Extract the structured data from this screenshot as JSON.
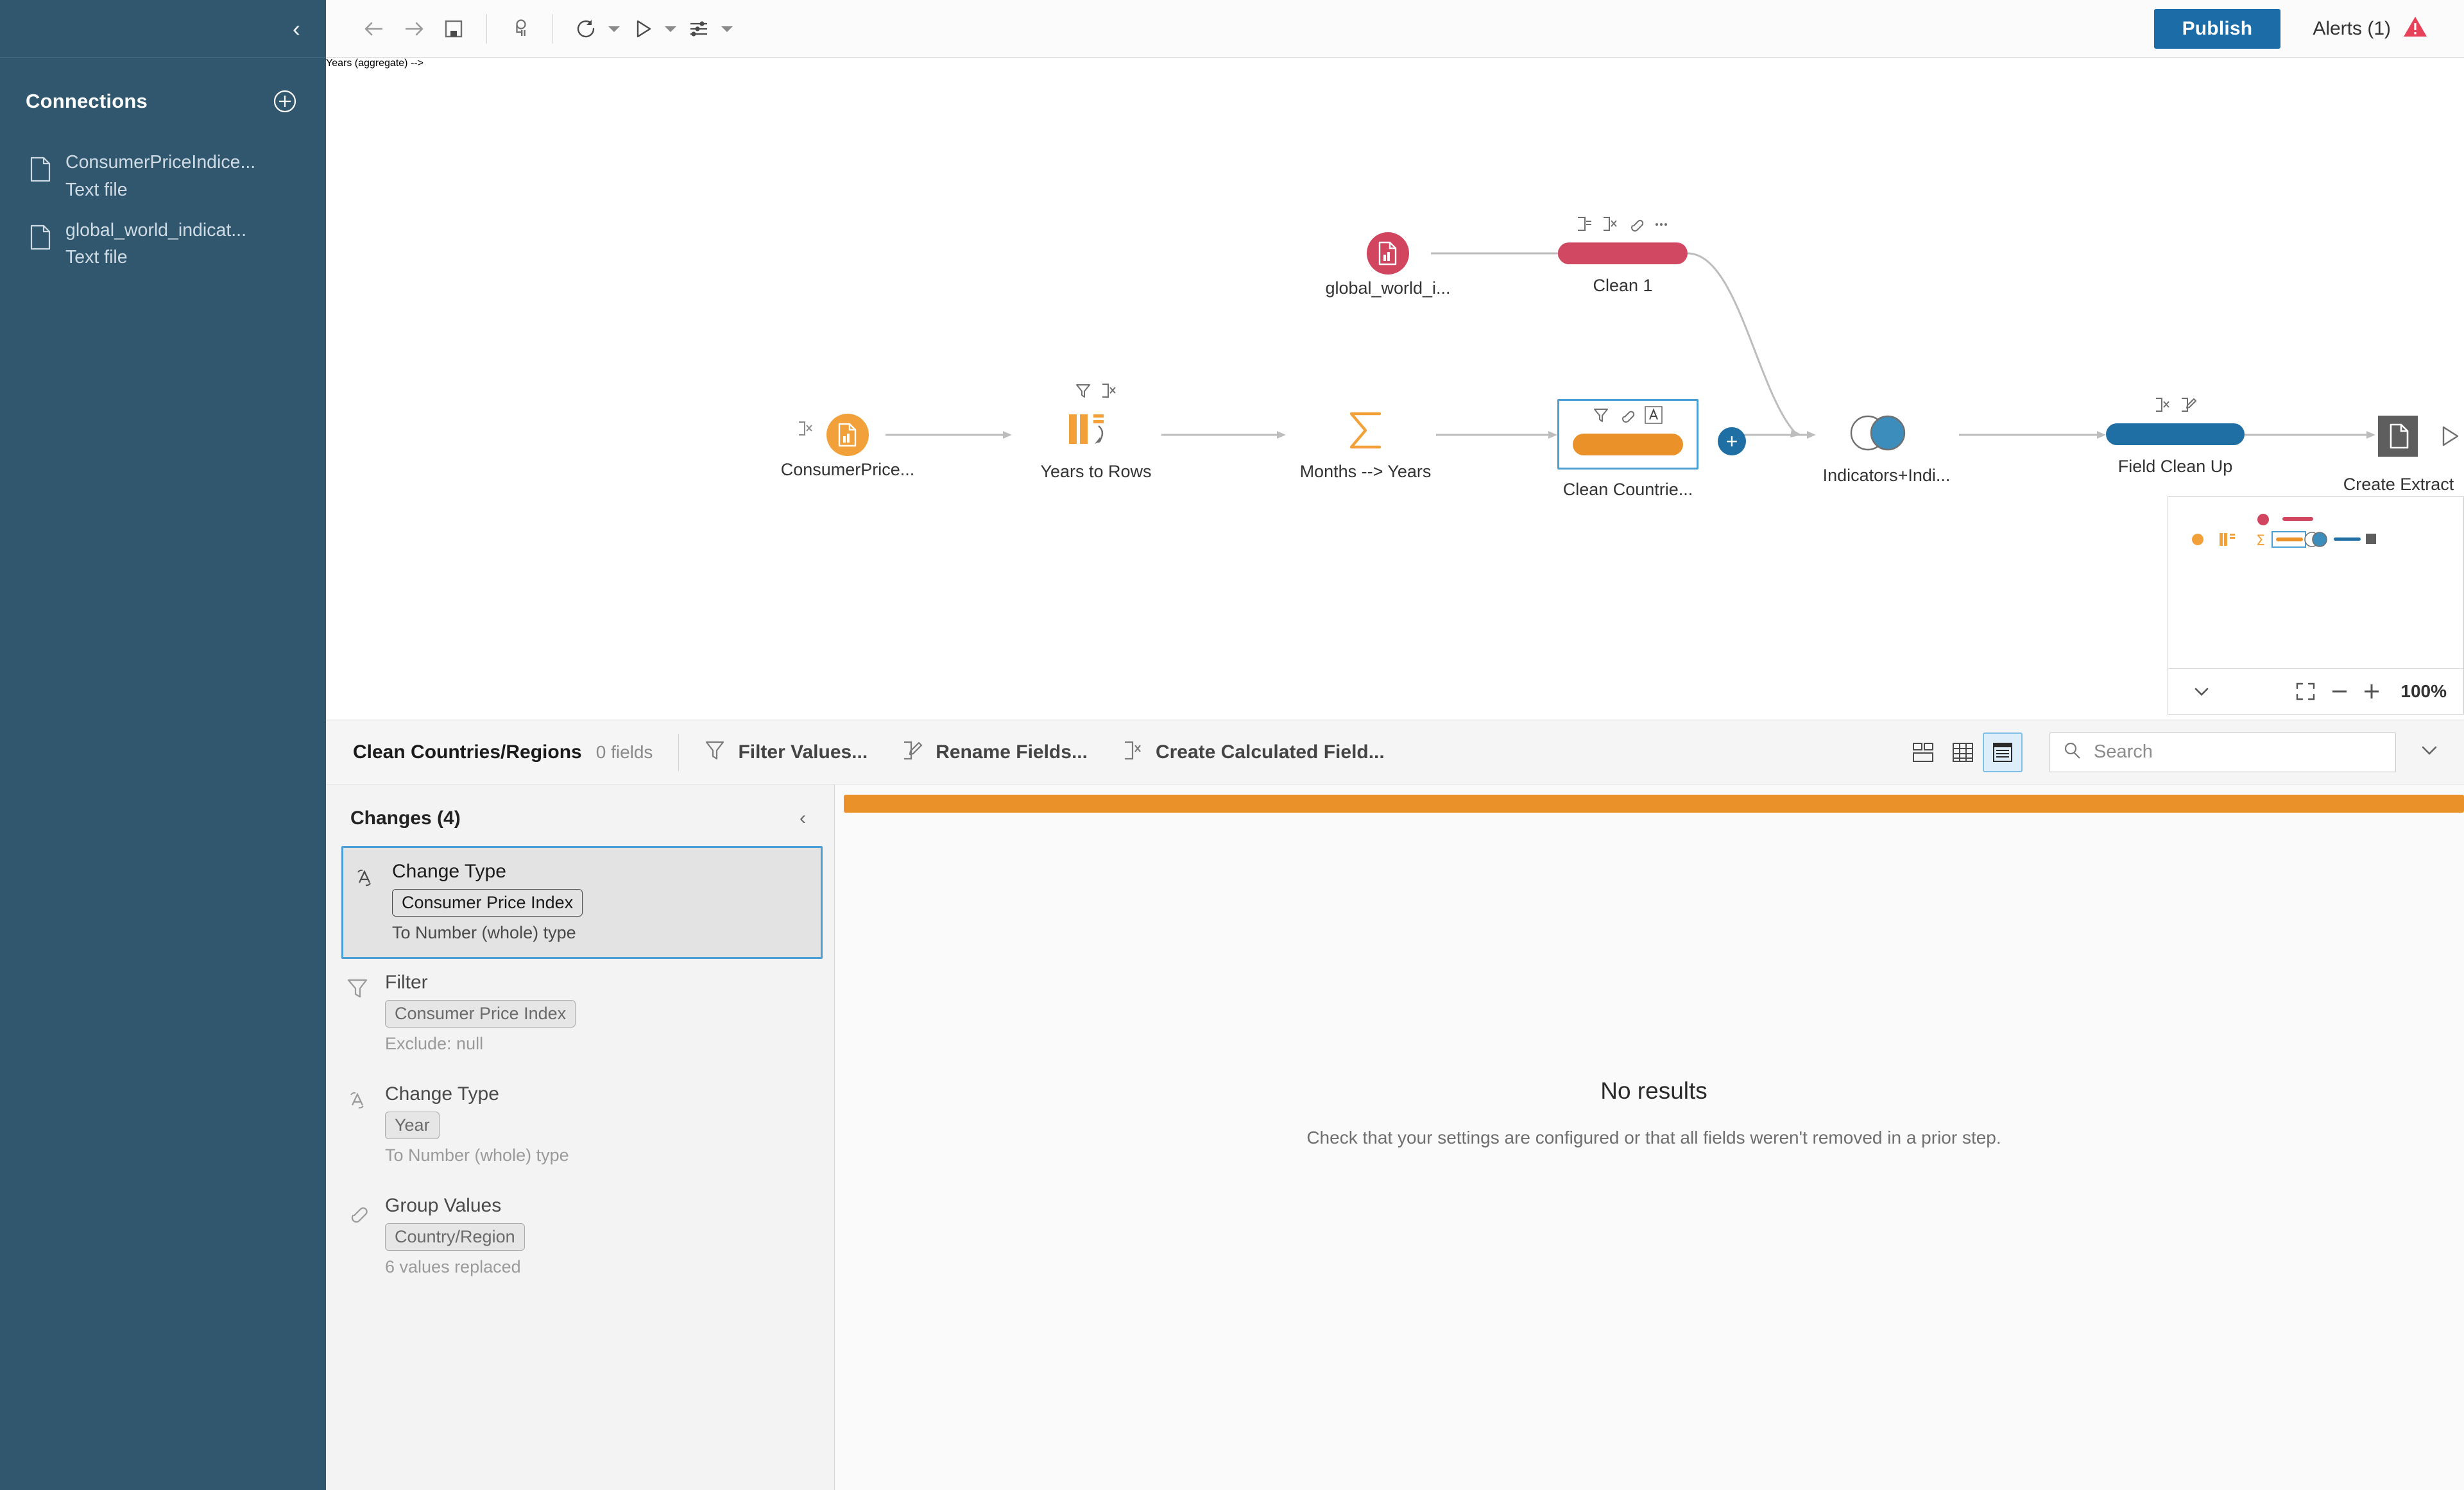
{
  "sidebar": {
    "collapse_icon": "chevron-left-icon",
    "connections_title": "Connections",
    "add_icon": "plus-circle-icon",
    "connections": [
      {
        "name": "ConsumerPriceIndice...",
        "type": "Text file",
        "icon": "file-icon"
      },
      {
        "name": "global_world_indicat...",
        "type": "Text file",
        "icon": "file-icon"
      }
    ]
  },
  "toolbar": {
    "undo_icon": "arrow-left-icon",
    "redo_icon": "arrow-right-icon",
    "save_icon": "save-icon",
    "pause_icon": "flow-pause-icon",
    "refresh_icon": "refresh-icon",
    "run_icon": "play-icon",
    "settings_icon": "sliders-icon",
    "publish_label": "Publish",
    "alerts_label": "Alerts (1)",
    "alerts_icon": "warning-triangle-icon",
    "publish_color": "#1c6ca8",
    "alert_color": "#e8415a"
  },
  "flow": {
    "nodes": [
      {
        "id": "global_world",
        "label": "global_world_i...",
        "type": "input-red"
      },
      {
        "id": "clean1",
        "label": "Clean 1",
        "type": "clean-red",
        "badges": [
          "rename-icon",
          "remove-field-icon",
          "group-values-icon",
          "more-icon"
        ]
      },
      {
        "id": "consumerprice",
        "label": "ConsumerPrice...",
        "type": "input-orange",
        "badges": [
          "remove-field-icon"
        ]
      },
      {
        "id": "years_to_rows",
        "label": "Years to Rows",
        "type": "pivot",
        "badges": [
          "filter-icon",
          "remove-field-icon"
        ]
      },
      {
        "id": "months_years",
        "label": "Months --> Years",
        "type": "aggregate"
      },
      {
        "id": "clean_countries",
        "label": "Clean Countrie...",
        "type": "clean-orange-selected",
        "badges": [
          "filter-icon",
          "group-values-icon",
          "change-type-icon"
        ]
      },
      {
        "id": "indicators",
        "label": "Indicators+Indi...",
        "type": "join"
      },
      {
        "id": "field_clean_up",
        "label": "Field Clean Up",
        "type": "clean-blue",
        "badges": [
          "remove-field-icon",
          "rename-field-icon"
        ]
      },
      {
        "id": "create_extract",
        "label": "Create Extract",
        "type": "output"
      }
    ],
    "add_step_icon": "plus-icon",
    "minimap": {
      "collapse_icon": "chevron-down-icon",
      "fit_icon": "fit-to-screen-icon",
      "zoom_out_icon": "minus-icon",
      "zoom_in_icon": "plus-icon",
      "zoom_level": "100%"
    }
  },
  "profile_toolbar": {
    "step_title": "Clean Countries/Regions",
    "field_count": "0 fields",
    "actions": [
      {
        "label": "Filter Values...",
        "icon": "filter-icon"
      },
      {
        "label": "Rename Fields...",
        "icon": "rename-field-icon"
      },
      {
        "label": "Create Calculated Field...",
        "icon": "calculated-field-icon"
      }
    ],
    "view_modes": [
      {
        "icon": "profile-view-icon",
        "active": false
      },
      {
        "icon": "grid-view-icon",
        "active": false
      },
      {
        "icon": "list-view-icon",
        "active": true
      }
    ],
    "search": {
      "placeholder": "Search",
      "value": "",
      "icon": "search-icon"
    },
    "more_icon": "chevron-down-icon"
  },
  "changes": {
    "title": "Changes (4)",
    "collapse_icon": "chevron-left-icon",
    "items": [
      {
        "title": "Change Type",
        "icon": "change-type-icon",
        "chip": "Consumer Price Index",
        "sub": "To Number (whole) type",
        "selected": true
      },
      {
        "title": "Filter",
        "icon": "filter-icon",
        "chip": "Consumer Price Index",
        "sub": "Exclude: null",
        "selected": false
      },
      {
        "title": "Change Type",
        "icon": "change-type-icon",
        "chip": "Year",
        "sub": "To Number (whole) type",
        "selected": false
      },
      {
        "title": "Group Values",
        "icon": "group-values-icon",
        "chip": "Country/Region",
        "sub": "6 values replaced",
        "selected": false
      }
    ]
  },
  "results": {
    "accent_color": "#eb9129",
    "title": "No results",
    "subtitle": "Check that your settings are configured or that all fields weren't removed in a prior step."
  }
}
